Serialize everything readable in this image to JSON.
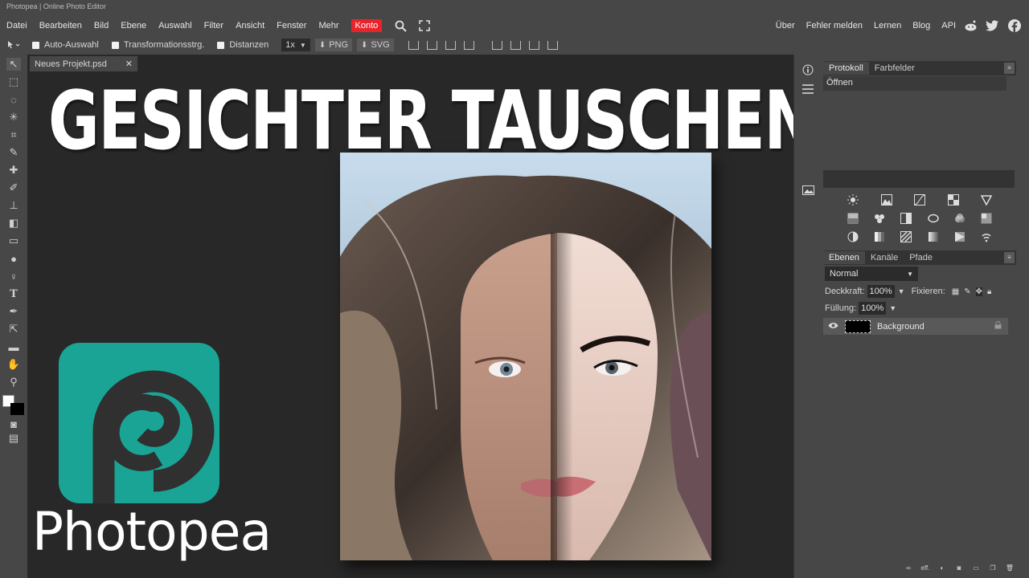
{
  "window": {
    "title": "Photopea | Online Photo Editor"
  },
  "menu": {
    "items": [
      "Datei",
      "Bearbeiten",
      "Bild",
      "Ebene",
      "Auswahl",
      "Filter",
      "Ansicht",
      "Fenster",
      "Mehr",
      "Konto"
    ],
    "right_items": [
      "Über",
      "Fehler melden",
      "Lernen",
      "Blog",
      "API"
    ],
    "account_color": "#e8242a"
  },
  "options": {
    "auto_select": "Auto-Auswahl",
    "transform": "Transformationsstrg.",
    "distances": "Distanzen",
    "zoom_value": "1x",
    "export_png": "PNG",
    "export_svg": "SVG"
  },
  "document": {
    "tab_title": "Neues Projekt.psd",
    "close_symbol": "✕"
  },
  "overlay": {
    "headline": "GESICHTER TAUSCHEN",
    "logo_text": "Photopea",
    "logo_color": "#1aa495"
  },
  "panels": {
    "history_tabs": [
      "Protokoll",
      "Farbfelder"
    ],
    "history_items": [
      "Öffnen"
    ],
    "layer_tabs": [
      "Ebenen",
      "Kanäle",
      "Pfade"
    ],
    "blend_mode": "Normal",
    "opacity_label": "Deckkraft:",
    "opacity_value": "100%",
    "lock_label": "Fixieren:",
    "fill_label": "Füllung:",
    "fill_value": "100%",
    "layers": [
      {
        "name": "Background",
        "visible": true,
        "locked": true
      }
    ],
    "footer_text": "eff."
  }
}
